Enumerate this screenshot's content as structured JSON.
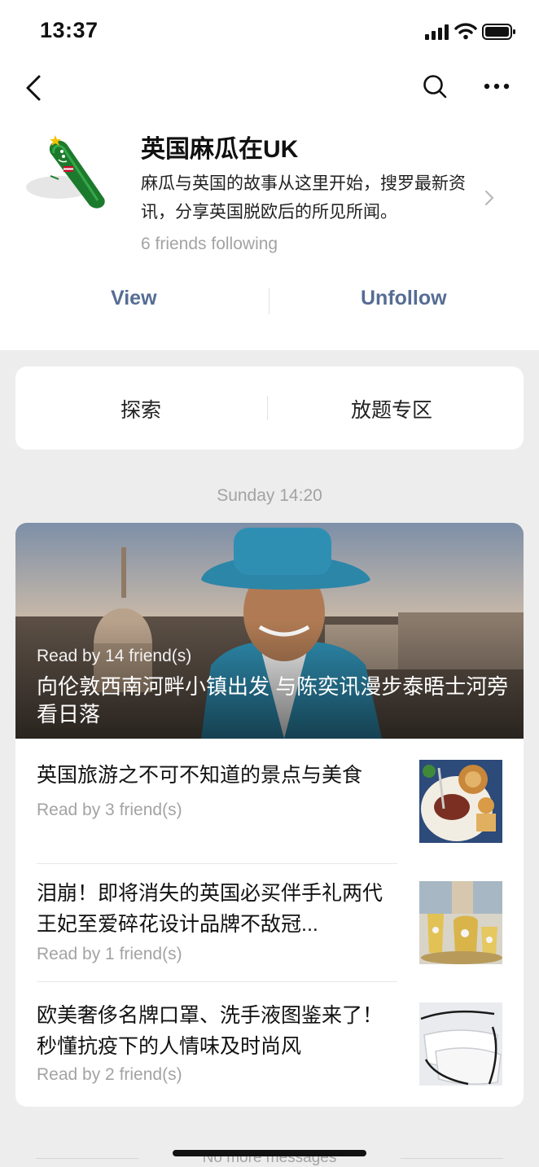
{
  "status_bar": {
    "time": "13:37"
  },
  "account": {
    "name": "英国麻瓜在UK",
    "description": "麻瓜与英国的故事从这里开始，搜罗最新资讯，分享英国脱欧后的所见所闻。",
    "friends_following": "6 friends following",
    "avatar_icon": "cucumber-mascot-icon"
  },
  "actions": {
    "view": "View",
    "unfollow": "Unfollow"
  },
  "menu": {
    "items": [
      "探索",
      "放题专区"
    ]
  },
  "feed": {
    "date": "Sunday 14:20",
    "featured": {
      "read_by": "Read by 14 friend(s)",
      "title": "向伦敦西南河畔小镇出发 与陈奕讯漫步泰晤士河旁看日落"
    },
    "articles": [
      {
        "title": "英国旅游之不可不知道的景点与美食",
        "read_by": "Read by 3 friend(s)",
        "thumb_icon": "roast-dinner-thumbnail"
      },
      {
        "title": "泪崩！即将消失的英国必买伴手礼两代王妃至爱碎花设计品牌不敌冠...",
        "read_by": "Read by 1 friend(s)",
        "thumb_icon": "floral-teaware-thumbnail"
      },
      {
        "title": "欧美奢侈名牌口罩、洗手液图鉴来了！ 秒懂抗疫下的人情味及时尚风",
        "read_by": "Read by 2 friend(s)",
        "thumb_icon": "face-masks-thumbnail"
      }
    ]
  },
  "footer": {
    "text": "No more messages"
  },
  "colors": {
    "link": "#566d94",
    "muted": "#a3a3a3",
    "background": "#ededed"
  }
}
